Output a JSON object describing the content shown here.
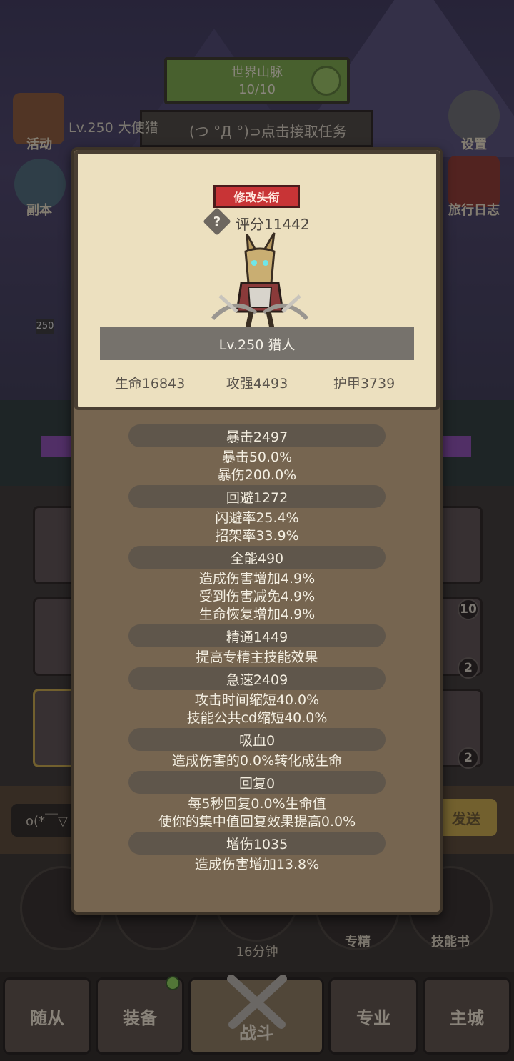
{
  "background": {
    "quest_board": {
      "title": "世界山脉",
      "progress": "10/10"
    },
    "task_hint": "(つ °Д °)⊃点击接取任务",
    "player_line": "Lv.250 大使猎",
    "side_buttons": {
      "activity": "活动",
      "dungeon": "副本",
      "settings": "设置",
      "travel_log": "旅行日志"
    },
    "level_badge": "250",
    "slot_badges": [
      "10",
      "2",
      "2"
    ],
    "chat_placeholder": "o(*￣▽",
    "send_label": "发送",
    "round_buttons": {
      "specialization": "专精",
      "skill_book": "技能书"
    },
    "timer": "16分钟",
    "nav": {
      "followers": "随从",
      "equipment": "装备",
      "battle": "战斗",
      "profession": "专业",
      "main_city": "主城"
    }
  },
  "modal": {
    "rename_button": "修改头衔",
    "help_icon": "?",
    "score": "评分11442",
    "hero_name": "Lv.250 猎人",
    "core_stats": {
      "hp": "生命16843",
      "attack": "攻强4493",
      "armor": "护甲3739"
    },
    "stat_groups": [
      {
        "header": "暴击2497",
        "lines": [
          "暴击50.0%",
          "暴伤200.0%"
        ]
      },
      {
        "header": "回避1272",
        "lines": [
          "闪避率25.4%",
          "招架率33.9%"
        ]
      },
      {
        "header": "全能490",
        "lines": [
          "造成伤害增加4.9%",
          "受到伤害减免4.9%",
          "生命恢复增加4.9%"
        ]
      },
      {
        "header": "精通1449",
        "lines": [
          "提高专精主技能效果"
        ]
      },
      {
        "header": "急速2409",
        "lines": [
          "攻击时间缩短40.0%",
          "技能公共cd缩短40.0%"
        ]
      },
      {
        "header": "吸血0",
        "lines": [
          "造成伤害的0.0%转化成生命"
        ]
      },
      {
        "header": "回复0",
        "lines": [
          "每5秒回复0.0%生命值",
          "使你的集中值回复效果提高0.0%"
        ]
      },
      {
        "header": "增伤1035",
        "lines": [
          "造成伤害增加13.8%"
        ]
      }
    ]
  },
  "colors": {
    "modal_bg": "#766550",
    "card_bg": "#ece0bf",
    "rename_red": "#c83436",
    "stat_pill": "#5f564b"
  }
}
